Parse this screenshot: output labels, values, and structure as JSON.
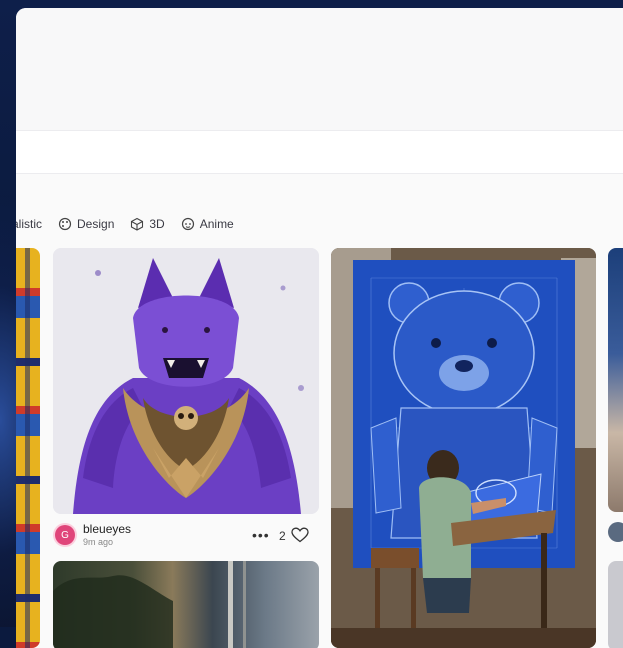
{
  "filters": [
    {
      "label": "alistic",
      "icon": "truncated-chip"
    },
    {
      "label": "Design",
      "icon": "palette-icon"
    },
    {
      "label": "3D",
      "icon": "cube-icon"
    },
    {
      "label": "Anime",
      "icon": "anime-face-icon"
    }
  ],
  "post": {
    "avatar_initial": "G",
    "username": "bleueyes",
    "time": "9m ago",
    "more": "•••",
    "likes": "2"
  },
  "colors": {
    "accent_avatar": "#e0457a",
    "backdrop": "#0b1a3e",
    "page_bg": "#fafafa"
  }
}
